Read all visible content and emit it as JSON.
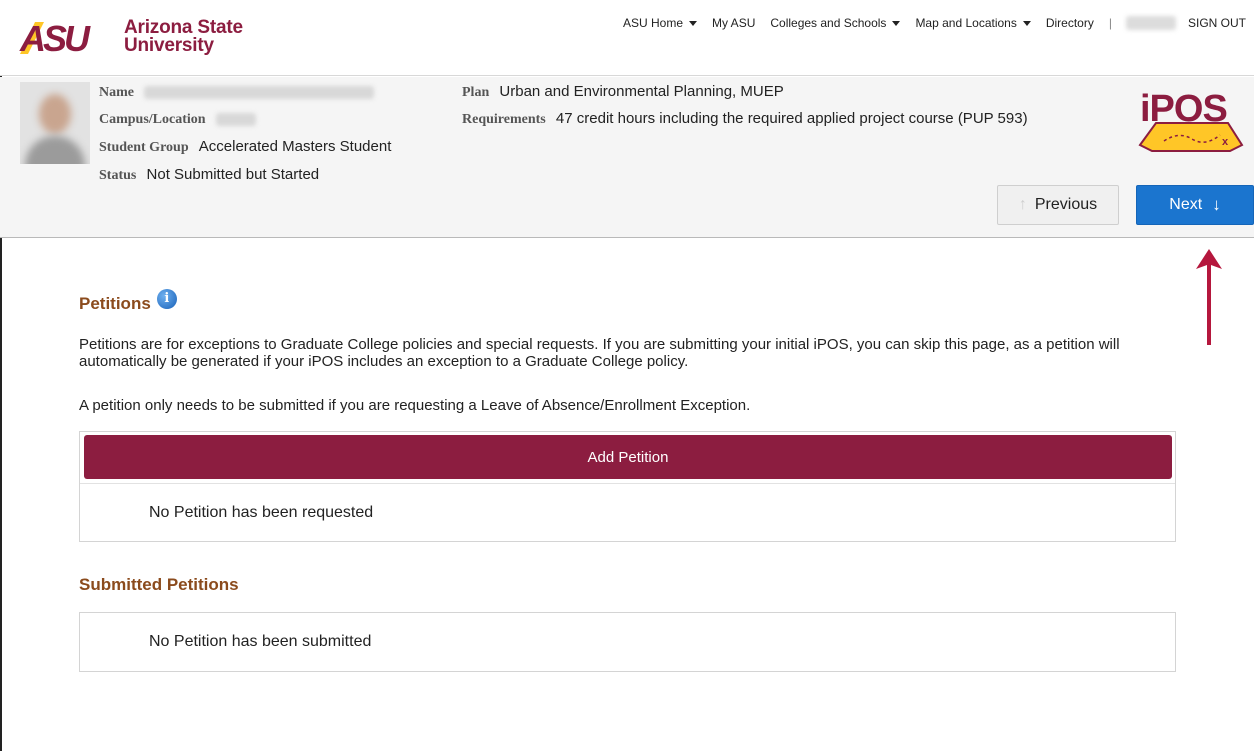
{
  "header": {
    "logo_mark": "ASU",
    "logo_line1": "Arizona State",
    "logo_line2": "University",
    "nav": [
      {
        "label": "ASU Home",
        "dropdown": true
      },
      {
        "label": "My ASU",
        "dropdown": false
      },
      {
        "label": "Colleges and Schools",
        "dropdown": true
      },
      {
        "label": "Map and Locations",
        "dropdown": true
      },
      {
        "label": "Directory",
        "dropdown": false
      }
    ],
    "separator": "|",
    "sign_out": "SIGN OUT"
  },
  "student": {
    "name_label": "Name",
    "campus_label": "Campus/Location",
    "group_label": "Student Group",
    "group_value": "Accelerated Masters Student",
    "status_label": "Status",
    "status_value": "Not Submitted but Started",
    "plan_label": "Plan",
    "plan_value": "Urban and Environmental Planning, MUEP",
    "requirements_label": "Requirements",
    "requirements_value": "47 credit hours including the required applied project course (PUP 593)"
  },
  "app_logo": "iPOS",
  "nav_buttons": {
    "previous": "Previous",
    "next": "Next"
  },
  "petitions": {
    "title": "Petitions",
    "info_glyph": "i",
    "description": "Petitions are for exceptions to Graduate College policies and special requests. If you are submitting your initial iPOS, you can skip this page, as a petition will automatically be generated if your iPOS includes an exception to a Graduate College policy.",
    "note": "A petition only needs to be submitted if you are requesting a Leave of Absence/Enrollment Exception.",
    "add_button": "Add Petition",
    "empty_requested": "No Petition has been requested"
  },
  "submitted": {
    "title": "Submitted Petitions",
    "empty_submitted": "No Petition has been submitted"
  },
  "colors": {
    "asu_maroon": "#8c1d40",
    "asu_gold": "#ffc627",
    "section_title": "#8b4b1d",
    "next_blue": "#1b75cf",
    "annotation": "#b5173d"
  }
}
